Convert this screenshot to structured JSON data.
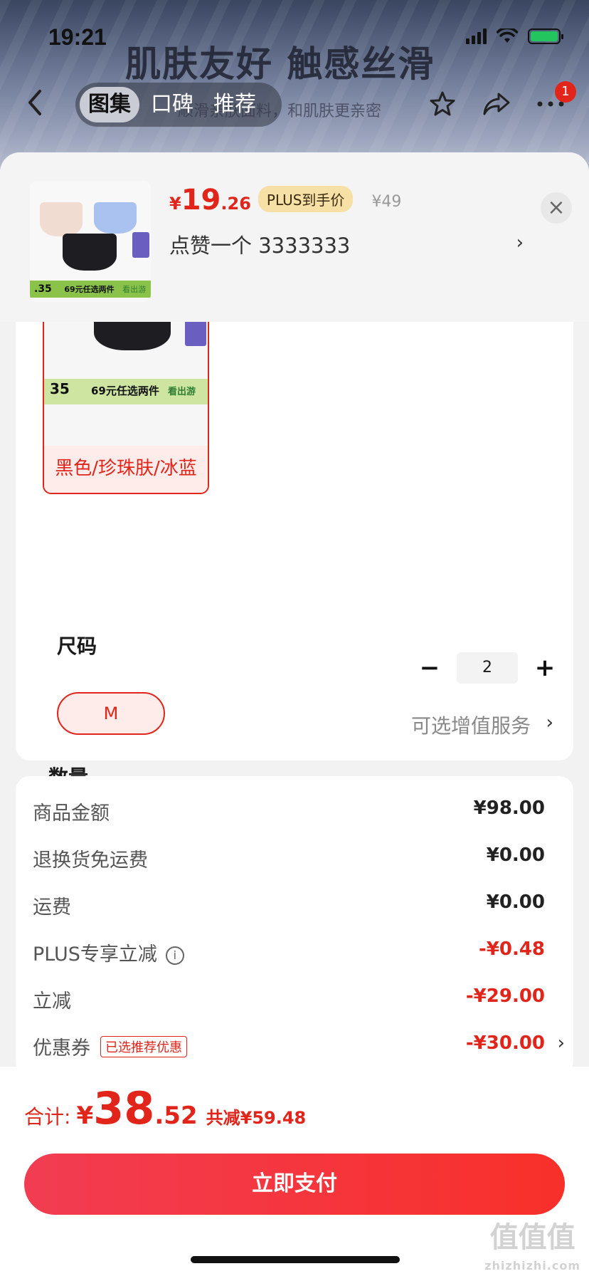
{
  "status_bar": {
    "time": "19:21"
  },
  "hero": {
    "title": "肌肤友好 触感丝滑",
    "subtitle": "顺滑亲肤面料，和肌肤更亲密"
  },
  "nav": {
    "tabs": [
      {
        "label": "图集",
        "active": true
      },
      {
        "label": "口碑"
      },
      {
        "label": "推荐"
      }
    ],
    "message_badge": "1"
  },
  "product": {
    "currency": "¥",
    "price_int": "19",
    "price_dec": ".26",
    "plus_tag": "PLUS到手价",
    "original_price": "¥49",
    "selected_text": "点赞一个  3333333",
    "thumb_banner": "69元任选两件",
    "thumb_price": ".35",
    "thumb_brand": "看出游"
  },
  "color": {
    "swatch_label": "黑色/珍珠肤/冰蓝",
    "banner": "69元任选两件",
    "price": "35",
    "brand": "看出游"
  },
  "size": {
    "label": "尺码",
    "selected": "M"
  },
  "quantity": {
    "label": "数量",
    "minus": "−",
    "value": "2",
    "plus": "+"
  },
  "service": {
    "label": "服务",
    "value": "可选增值服务"
  },
  "fees": [
    {
      "key": "商品金额",
      "value": "¥98.00",
      "red": false
    },
    {
      "key": "退换货免运费",
      "value": "¥0.00",
      "red": false
    },
    {
      "key": "运费",
      "value": "¥0.00",
      "red": false
    },
    {
      "key": "PLUS专享立减",
      "value": "-¥0.48",
      "red": true
    },
    {
      "key": "立减",
      "value": "-¥29.00",
      "red": true
    },
    {
      "key": "优惠券",
      "value": "-¥30.00",
      "red": true,
      "tag": "已选推荐优惠"
    }
  ],
  "total": {
    "label": "合计:",
    "yen": "¥",
    "int": "38",
    "dec": ".52",
    "saved": "共减¥59.48"
  },
  "pay_button": "立即支付",
  "watermark": {
    "main": "值值值",
    "url": "zhizhizhi.com"
  },
  "colors": {
    "accent_red": "#e1251b",
    "plus_gold": "#f6e0a6"
  }
}
